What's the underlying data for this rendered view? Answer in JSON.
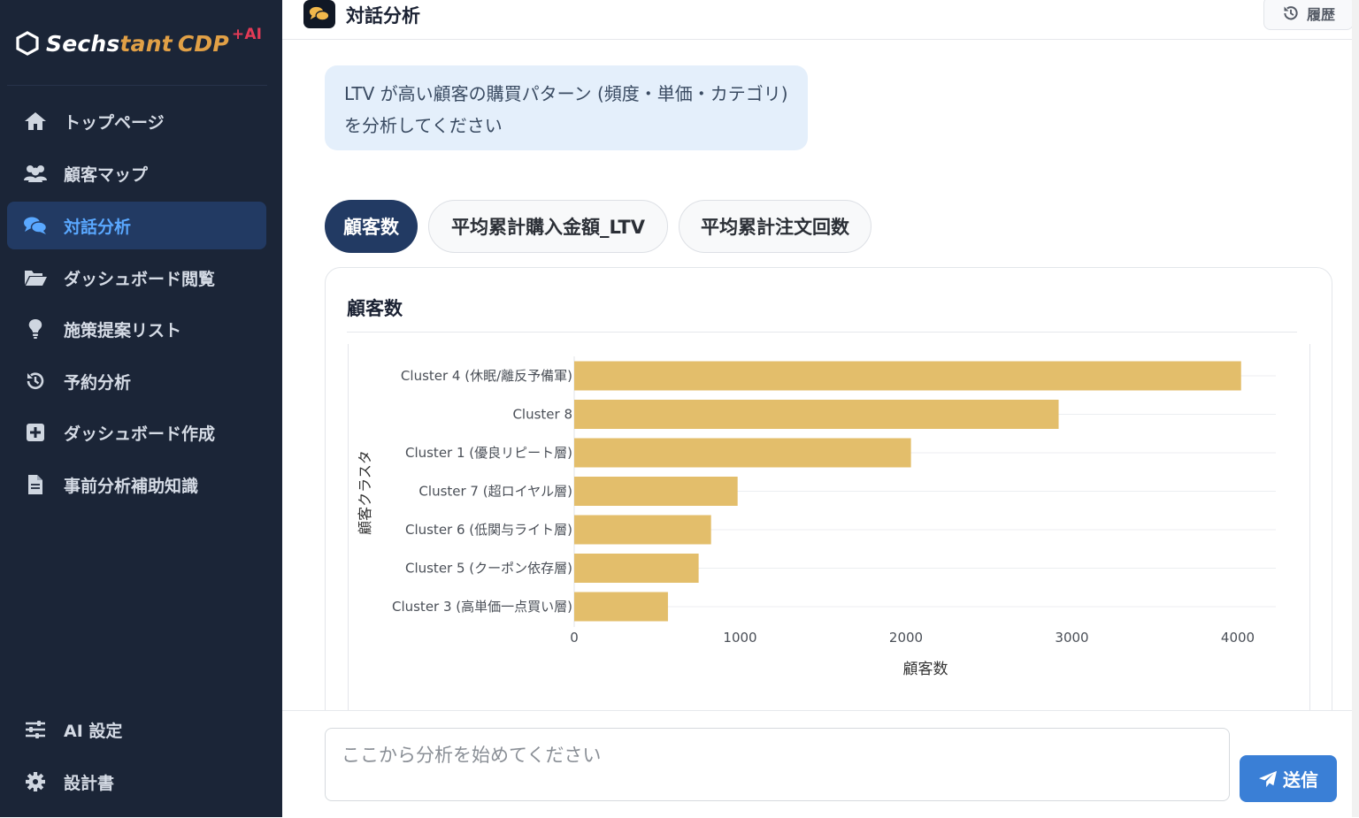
{
  "brand": {
    "part1": "Sechs",
    "part2": "tant",
    "part3": "CDP",
    "suffix": "+AI"
  },
  "sidebar": {
    "items": [
      {
        "label": "トップページ",
        "icon": "home-icon"
      },
      {
        "label": "顧客マップ",
        "icon": "users-icon"
      },
      {
        "label": "対話分析",
        "icon": "comments-icon",
        "active": true
      },
      {
        "label": "ダッシュボード閲覧",
        "icon": "folder-open-icon"
      },
      {
        "label": "施策提案リスト",
        "icon": "lightbulb-icon"
      },
      {
        "label": "予約分析",
        "icon": "history-icon"
      },
      {
        "label": "ダッシュボード作成",
        "icon": "plus-square-icon"
      },
      {
        "label": "事前分析補助知識",
        "icon": "file-icon"
      }
    ],
    "bottom_items": [
      {
        "label": "AI 設定",
        "icon": "sliders-icon"
      },
      {
        "label": "設計書",
        "icon": "gear-icon"
      }
    ]
  },
  "header": {
    "title": "対話分析",
    "history_label": "履歴"
  },
  "chat": {
    "user_message": "LTV が高い顧客の購買パターン (頻度・単価・カテゴリ) を分析してください"
  },
  "tabs": [
    {
      "label": "顧客数",
      "active": true
    },
    {
      "label": "平均累計購入金額_LTV",
      "active": false
    },
    {
      "label": "平均累計注文回数",
      "active": false
    }
  ],
  "card": {
    "title": "顧客数"
  },
  "chart_data": {
    "type": "bar",
    "orientation": "horizontal",
    "categories": [
      "Cluster 4 (休眠/離反予備軍)",
      "Cluster 8",
      "Cluster 1 (優良リピート層)",
      "Cluster 7 (超ロイヤル層)",
      "Cluster 6 (低関与ライト層)",
      "Cluster 5 (クーポン依存層)",
      "Cluster 3 (高単価一点買い層)"
    ],
    "values": [
      4020,
      2920,
      2030,
      985,
      825,
      750,
      565
    ],
    "xlabel": "顧客数",
    "ylabel": "顧客クラスタ",
    "xlim": [
      0,
      4200
    ],
    "xticks": [
      "0",
      "1000",
      "2000",
      "3000",
      "4000"
    ],
    "bar_color": "#e3be6b",
    "grid": true
  },
  "input": {
    "placeholder": "ここから分析を始めてください",
    "send_label": "送信"
  },
  "colors": {
    "sidebar_bg": "#1b2537",
    "accent": "#3a7fd6",
    "active_nav": "#223a63"
  }
}
